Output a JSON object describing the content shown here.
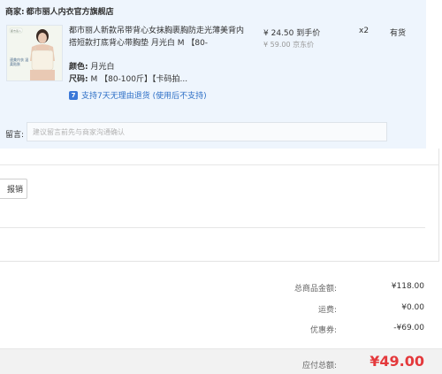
{
  "merchant": {
    "label": "商家:",
    "name": "都市丽人内衣官方旗舰店"
  },
  "product": {
    "image_caption_top": "都市丽人",
    "image_caption_bottom": "速美内衣 温柔贴肤",
    "title": "都市丽人新款吊带背心女抹胸裹胸防走光薄美背内搭短款打底背心带胸垫 月光白 M 【80-",
    "price_now": "¥ 24.50 到手价",
    "price_orig": "¥ 59.00 京东价",
    "qty": "x2",
    "stock": "有货",
    "color_key": "颜色:",
    "color_val": "月光白",
    "size_key": "尺码:",
    "size_val": "M 【80-100斤】【卡码拍...",
    "service_icon": "7",
    "service_text": "支持7天无理由退货 (使用后不支持)"
  },
  "note": {
    "label": "留言:",
    "placeholder": "建议留言前先与商家沟通确认"
  },
  "invoice": {
    "button_label": "报销"
  },
  "summary": {
    "goods_total_label": "总商品金额:",
    "goods_total_value": "¥118.00",
    "shipping_label": "运费:",
    "shipping_value": "¥0.00",
    "coupon_label": "优惠券:",
    "coupon_value": "-¥69.00",
    "payable_label": "应付总额:",
    "payable_value": "¥49.00"
  },
  "colors": {
    "panel_bg": "#eef5fd",
    "accent_red": "#e4393c",
    "link_blue": "#2d6fc6"
  }
}
